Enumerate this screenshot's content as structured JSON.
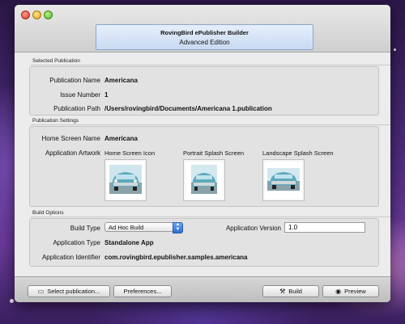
{
  "window": {
    "title": "RovingBird ePublisher Builder",
    "subtitle": "Advanced Edition"
  },
  "selected_publication": {
    "section_title": "Selected Publication",
    "fields": [
      {
        "label": "Publication Name",
        "value": "Americana"
      },
      {
        "label": "Issue Number",
        "value": "1"
      },
      {
        "label": "Publication Path",
        "value": "/Users/rovingbird/Documents/Americana 1.publication"
      }
    ]
  },
  "publication_settings": {
    "section_title": "Publication Settings",
    "home_screen_name_label": "Home Screen Name",
    "home_screen_name_value": "Americana",
    "artwork_label": "Application Artwork",
    "artwork": [
      {
        "label": "Home Screen Icon"
      },
      {
        "label": "Portrait Splash Screen"
      },
      {
        "label": "Landscape Splash Screen"
      }
    ]
  },
  "build_options": {
    "section_title": "Build Options",
    "build_type_label": "Build Type",
    "build_type_value": "Ad Hoc Build",
    "app_version_label": "Application Version",
    "app_version_value": "1.0",
    "app_type_label": "Application Type",
    "app_type_value": "Standalone App",
    "app_id_label": "Application Identifier",
    "app_id_value": "com.rovingbird.epublisher.samples.americana"
  },
  "toolbar": {
    "select_publication": "Select publication...",
    "preferences": "Preferences...",
    "build": "Build",
    "preview": "Preview"
  },
  "icons": {
    "select_publication": "folder-icon",
    "build": "hammer-icon",
    "preview": "eye-icon"
  }
}
